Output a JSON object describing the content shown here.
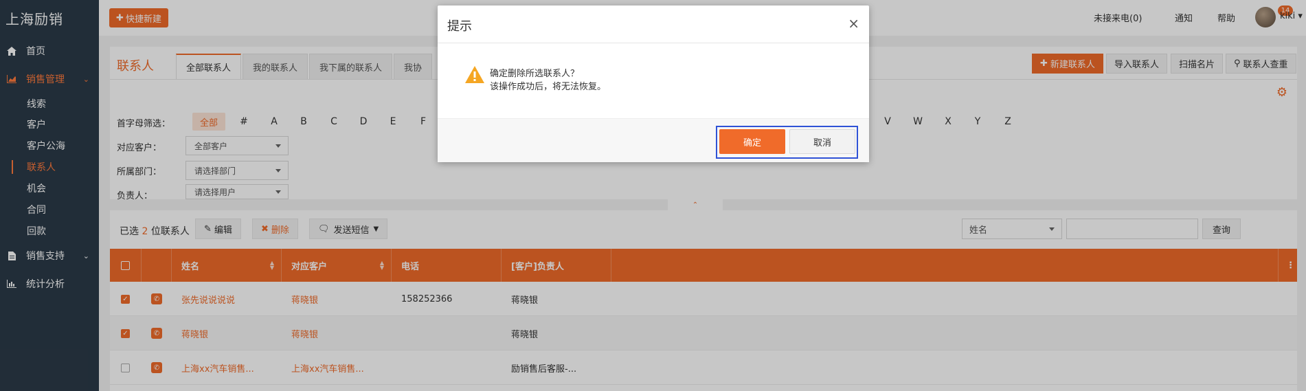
{
  "app": {
    "brand": "上海励销"
  },
  "sidebar": {
    "items": [
      {
        "label": "首页",
        "icon": "home-icon"
      },
      {
        "label": "销售管理",
        "icon": "chart-area-icon",
        "expanded": true
      },
      {
        "label": "销售支持",
        "icon": "document-icon"
      },
      {
        "label": "统计分析",
        "icon": "bar-chart-icon"
      }
    ],
    "sub_items": [
      "线索",
      "客户",
      "客户公海",
      "联系人",
      "机会",
      "合同",
      "回款"
    ],
    "active_sub": "联系人"
  },
  "topbar": {
    "quick_new": "快捷新建",
    "missed_calls": "未接来电(0)",
    "notify": "通知",
    "notify_badge": "14",
    "help": "帮助",
    "user": "kiki"
  },
  "page": {
    "title": "联系人",
    "tabs": [
      "全部联系人",
      "我的联系人",
      "我下属的联系人",
      "我协"
    ],
    "actions": {
      "new": "新建联系人",
      "import": "导入联系人",
      "scan": "扫描名片",
      "dedupe": "联系人查重"
    }
  },
  "filters": {
    "letter_label": "首字母筛选：",
    "letters_left": [
      "全部",
      "#",
      "A",
      "B",
      "C",
      "D",
      "E",
      "F"
    ],
    "letters_right": [
      "V",
      "W",
      "X",
      "Y",
      "Z"
    ],
    "customer_label": "对应客户：",
    "customer_value": "全部客户",
    "dept_label": "所属部门：",
    "dept_placeholder": "请选择部门",
    "owner_label": "负责人：",
    "owner_placeholder": "请选择用户"
  },
  "toolbar": {
    "selected_prefix": "已选",
    "selected_count": "2",
    "selected_suffix": "位联系人",
    "edit": "编辑",
    "delete": "删除",
    "sms": "发送短信",
    "search_field": "姓名",
    "search_btn": "查询"
  },
  "table": {
    "columns": [
      "姓名",
      "对应客户",
      "电话",
      "[客户]负责人"
    ],
    "rows": [
      {
        "checked": true,
        "name": "张先说说说说",
        "customer": "蒋晓银",
        "phone": "158252366",
        "owner": "蒋晓银"
      },
      {
        "checked": true,
        "name": "蒋晓银",
        "customer": "蒋晓银",
        "phone": "",
        "owner": "蒋晓银"
      },
      {
        "checked": false,
        "name": "上海xx汽车销售...",
        "customer": "上海xx汽车销售...",
        "phone": "",
        "owner": "励销售后客服-..."
      }
    ]
  },
  "dialog": {
    "title": "提示",
    "line1": "确定删除所选联系人？",
    "line2": "该操作成功后，将无法恢复。",
    "ok": "确定",
    "cancel": "取消"
  },
  "colors": {
    "accent": "#f06b2a",
    "sidebar": "#2b3a48",
    "highlight": "#2f52d6"
  }
}
